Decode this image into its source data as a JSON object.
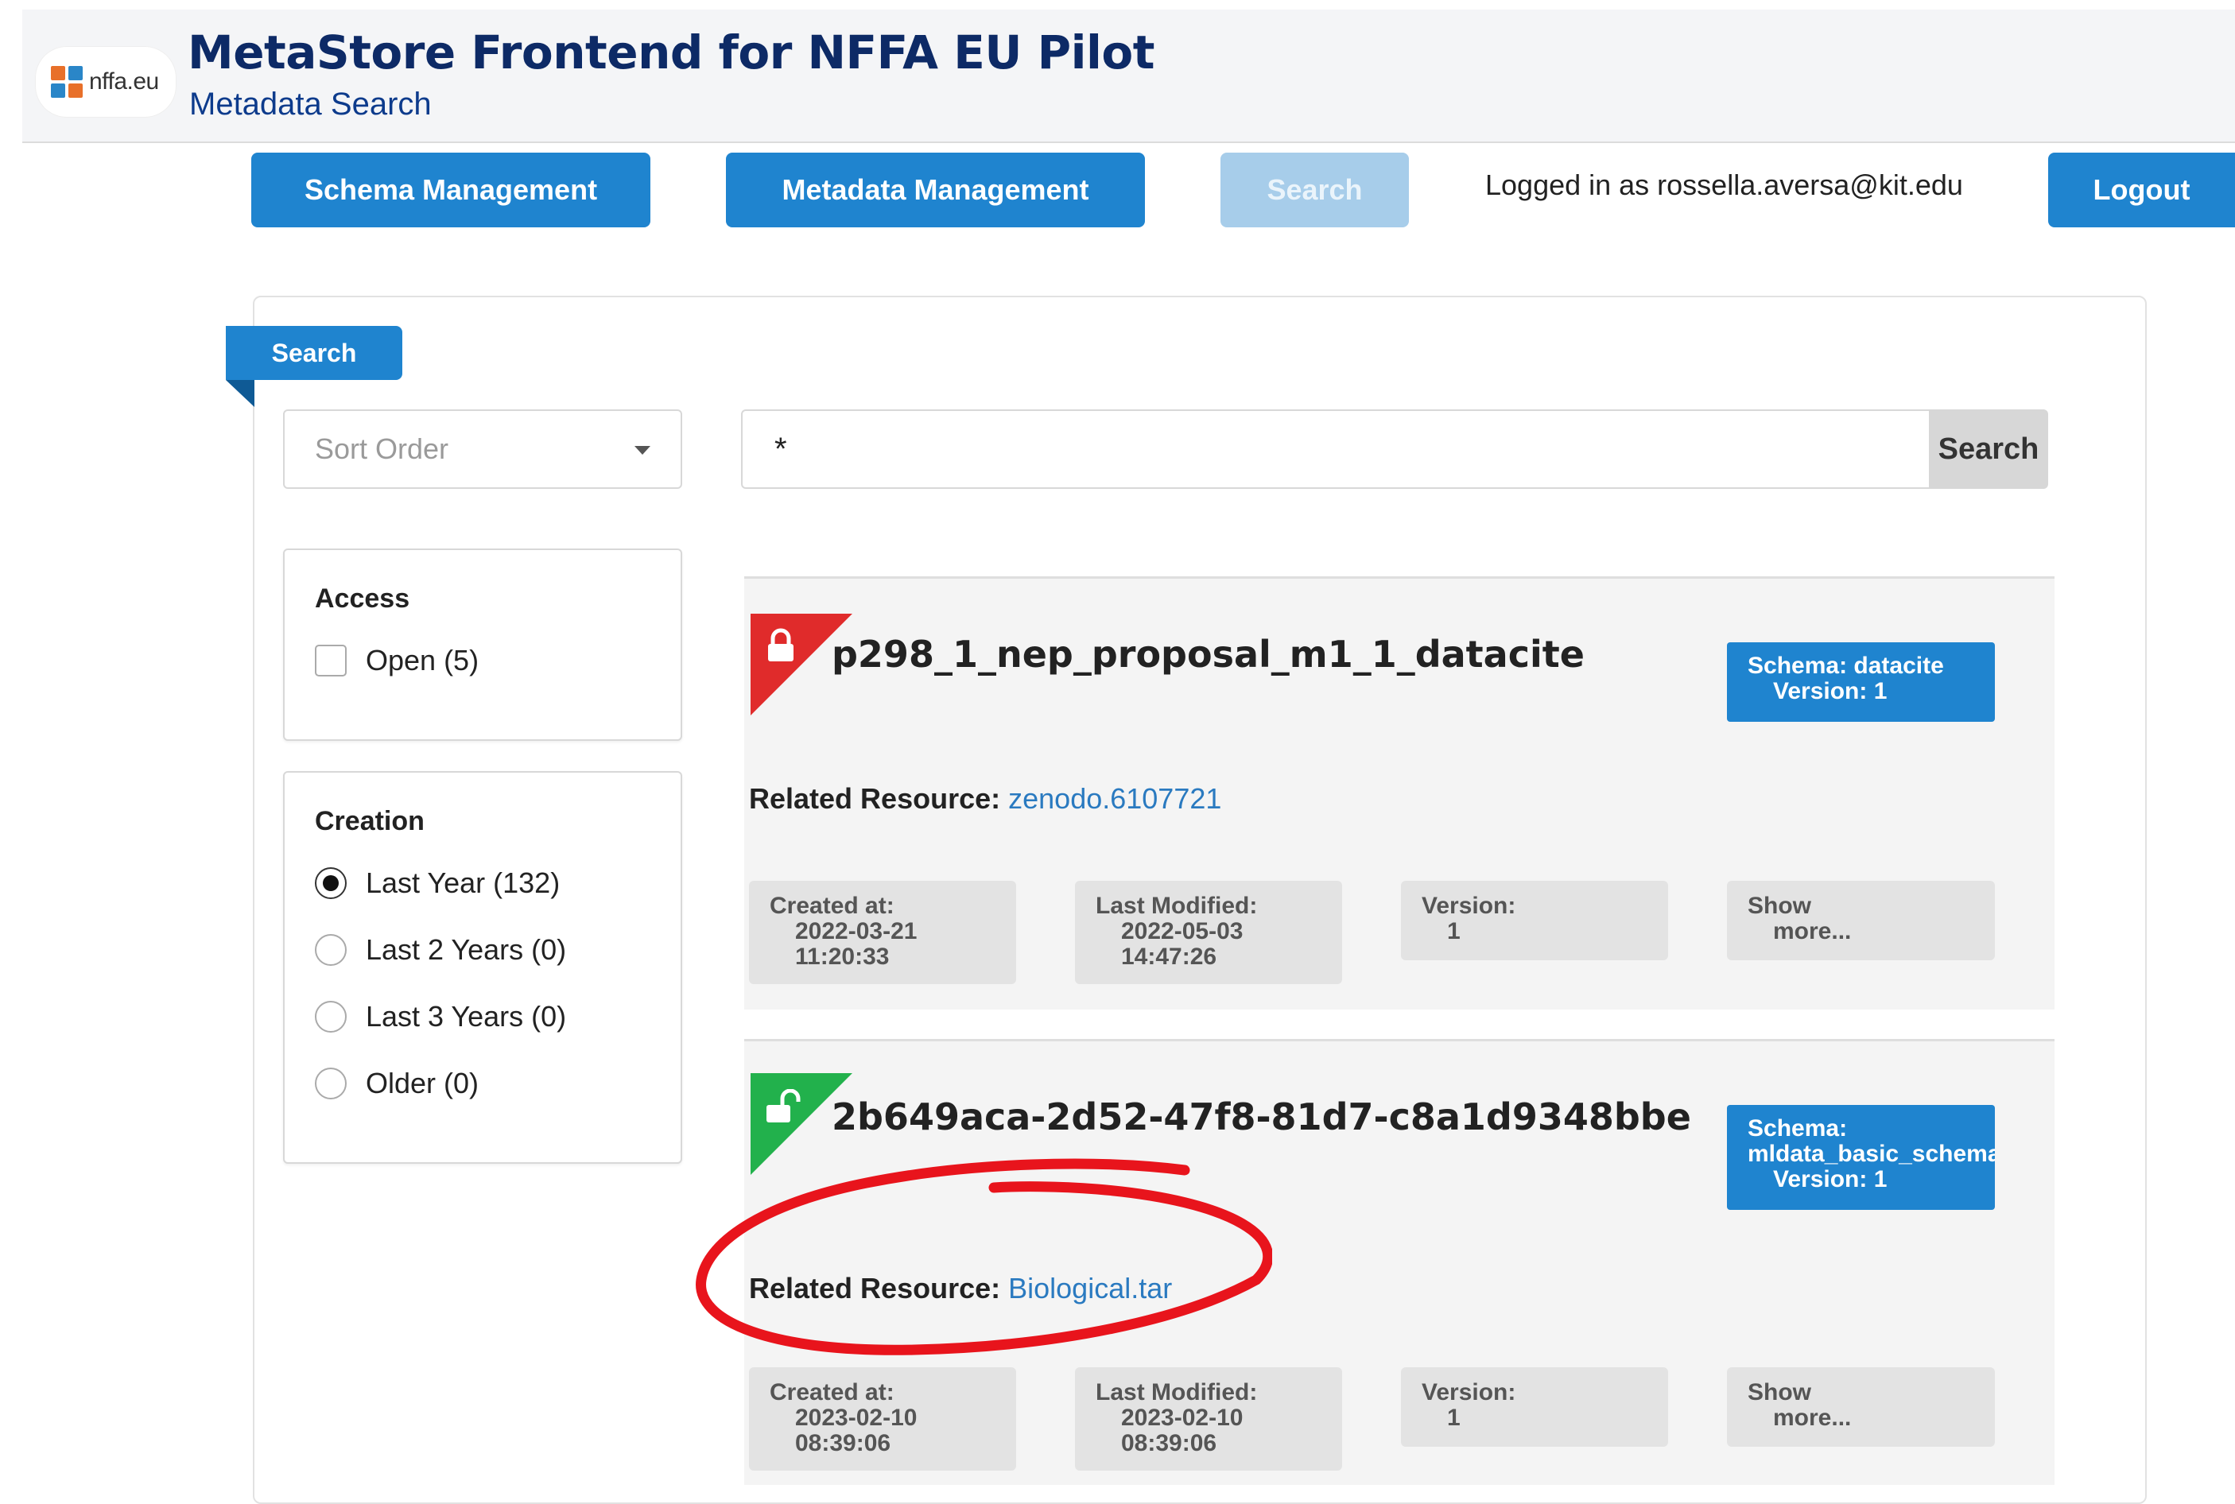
{
  "header": {
    "logo_text": "nffa.eu",
    "title": "MetaStore Frontend for NFFA EU Pilot",
    "subtitle": "Metadata Search"
  },
  "nav": {
    "schema_management": "Schema Management",
    "metadata_management": "Metadata Management",
    "search": "Search",
    "logged_in": "Logged in as rossella.aversa@kit.edu",
    "logout": "Logout"
  },
  "panel": {
    "tag": "Search",
    "sort_placeholder": "Sort Order",
    "query_value": "*",
    "search_button": "Search"
  },
  "facets": {
    "access": {
      "title": "Access",
      "options": [
        {
          "label": "Open (5)",
          "checked": false
        }
      ]
    },
    "creation": {
      "title": "Creation",
      "options": [
        {
          "label": "Last Year (132)",
          "selected": true
        },
        {
          "label": "Last 2 Years (0)",
          "selected": false
        },
        {
          "label": "Last 3 Years (0)",
          "selected": false
        },
        {
          "label": "Older (0)",
          "selected": false
        }
      ]
    }
  },
  "results": [
    {
      "access": "restricted",
      "ribbon_color": "#e02b2b",
      "title": "p298_1_nep_proposal_m1_1_datacite",
      "schema_line": "Schema: datacite",
      "schema_version": "Version: 1",
      "related_label": "Related Resource:",
      "related_value": "zenodo.6107721",
      "created_label": "Created at:",
      "created_date": "2022-03-21",
      "created_time": "11:20:33",
      "modified_label": "Last Modified:",
      "modified_date": "2022-05-03",
      "modified_time": "14:47:26",
      "version_label": "Version:",
      "version_value": "1",
      "show_label": "Show",
      "more_label": "more..."
    },
    {
      "access": "open",
      "ribbon_color": "#22b14c",
      "title": "2b649aca-2d52-47f8-81d7-c8a1d9348bbe",
      "schema_line": "Schema:",
      "schema_name": "mldata_basic_schema",
      "schema_version": "Version: 1",
      "related_label": "Related Resource:",
      "related_value": "Biological.tar",
      "created_label": "Created at:",
      "created_date": "2023-02-10",
      "created_time": "08:39:06",
      "modified_label": "Last Modified:",
      "modified_date": "2023-02-10",
      "modified_time": "08:39:06",
      "version_label": "Version:",
      "version_value": "1",
      "show_label": "Show",
      "more_label": "more..."
    }
  ],
  "annotation": {
    "color": "#e8141c"
  }
}
